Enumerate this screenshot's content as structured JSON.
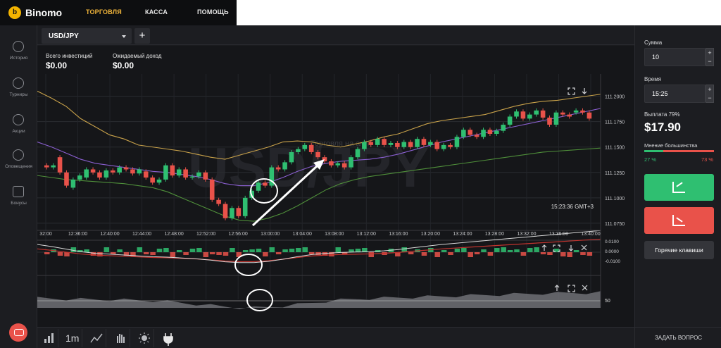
{
  "header": {
    "brand": "Binomo",
    "nav": [
      "ТОРГОВЛЯ",
      "КАССА",
      "ПОМОЩЬ"
    ]
  },
  "sidebar": {
    "items": [
      "История",
      "Турниры",
      "Акции",
      "Оповещения",
      "Бонусы"
    ]
  },
  "asset_tab": {
    "name": "USD/JPY",
    "add_label": "+"
  },
  "stats": {
    "investments_label": "Всего инвестиций",
    "investments_value": "$0.00",
    "income_label": "Ожидаемый доход",
    "income_value": "$0.00"
  },
  "chart": {
    "watermark": "USD/JPY",
    "watermark_caption": "Торговля на акти",
    "time_readout": "15:23:36 GMT+3",
    "indicator_level": "50",
    "colors": {
      "up": "#2fbf71",
      "down": "#e9524a",
      "upper_band": "#c9a24a",
      "mid_band": "#8a5fd0",
      "lower_band": "#4f8f3a",
      "macd_signal": "#c0332e",
      "macd_line": "#d9d9d9"
    }
  },
  "chart_data": {
    "type": "line",
    "x_ticks": [
      "32:00",
      "12:36:00",
      "12:40:00",
      "12:44:00",
      "12:48:00",
      "12:52:00",
      "12:56:00",
      "13:00:00",
      "13:04:00",
      "13:08:00",
      "13:12:00",
      "13:16:00",
      "13:20:00",
      "13:24:00",
      "13:28:00",
      "13:32:00",
      "13:36:00",
      "13:40:00"
    ],
    "y_ticks": [
      "111.2000",
      "111.1750",
      "111.1500",
      "111.1250",
      "111.1000",
      "111.0750"
    ],
    "macd_ticks": [
      "0.0100",
      "0.0000",
      "-0.0100"
    ],
    "ylim": [
      111.068,
      111.215
    ],
    "candles": [
      [
        111.132,
        111.13
      ],
      [
        111.13,
        111.132
      ],
      [
        111.14,
        111.125
      ],
      [
        111.125,
        111.112
      ],
      [
        111.11,
        111.118
      ],
      [
        111.118,
        111.122
      ],
      [
        111.12,
        111.128
      ],
      [
        111.128,
        111.125
      ],
      [
        111.125,
        111.12
      ],
      [
        111.12,
        111.127
      ],
      [
        111.127,
        111.125
      ],
      [
        111.125,
        111.13
      ],
      [
        111.13,
        111.128
      ],
      [
        111.128,
        111.124
      ],
      [
        111.124,
        111.128
      ],
      [
        111.126,
        111.12
      ],
      [
        111.12,
        111.115
      ],
      [
        111.115,
        111.118
      ],
      [
        111.118,
        111.132
      ],
      [
        111.132,
        111.122
      ],
      [
        111.122,
        111.128
      ],
      [
        111.128,
        111.12
      ],
      [
        111.12,
        111.121
      ],
      [
        111.121,
        111.125
      ],
      [
        111.125,
        111.118
      ],
      [
        111.118,
        111.098
      ],
      [
        111.098,
        111.094
      ],
      [
        111.094,
        111.08
      ],
      [
        111.08,
        111.09
      ],
      [
        111.09,
        111.082
      ],
      [
        111.082,
        111.1
      ],
      [
        111.1,
        111.107
      ],
      [
        111.107,
        111.115
      ],
      [
        111.115,
        111.112
      ],
      [
        111.112,
        111.13
      ],
      [
        111.13,
        111.128
      ],
      [
        111.128,
        111.135
      ],
      [
        111.135,
        111.145
      ],
      [
        111.145,
        111.148
      ],
      [
        111.148,
        111.152
      ],
      [
        111.152,
        111.145
      ],
      [
        111.145,
        111.14
      ],
      [
        111.14,
        111.136
      ],
      [
        111.136,
        111.132
      ],
      [
        111.132,
        111.134
      ],
      [
        111.134,
        111.13
      ],
      [
        111.13,
        111.14
      ],
      [
        111.14,
        111.148
      ],
      [
        111.148,
        111.155
      ],
      [
        111.155,
        111.152
      ],
      [
        111.152,
        111.158
      ],
      [
        111.158,
        111.152
      ],
      [
        111.152,
        111.154
      ],
      [
        111.154,
        111.15
      ],
      [
        111.15,
        111.155
      ],
      [
        111.155,
        111.15
      ],
      [
        111.15,
        111.158
      ],
      [
        111.158,
        111.152
      ],
      [
        111.152,
        111.155
      ],
      [
        111.155,
        111.148
      ],
      [
        111.148,
        111.152
      ],
      [
        111.152,
        111.15
      ],
      [
        111.15,
        111.16
      ],
      [
        111.16,
        111.167
      ],
      [
        111.167,
        111.162
      ],
      [
        111.162,
        111.16
      ],
      [
        111.16,
        111.167
      ],
      [
        111.167,
        111.163
      ],
      [
        111.163,
        111.166
      ],
      [
        111.166,
        111.172
      ],
      [
        111.172,
        111.18
      ],
      [
        111.18,
        111.185
      ],
      [
        111.185,
        111.178
      ],
      [
        111.178,
        111.182
      ],
      [
        111.182,
        111.186
      ],
      [
        111.186,
        111.179
      ],
      [
        111.179,
        111.172
      ],
      [
        111.172,
        111.184
      ],
      [
        111.184,
        111.182
      ],
      [
        111.182,
        111.18
      ],
      [
        111.184,
        111.186
      ],
      [
        111.186,
        111.184
      ],
      [
        111.184,
        111.178
      ]
    ],
    "series": [
      {
        "values": [
          111.205,
          111.198,
          111.19,
          111.178,
          111.17,
          111.162,
          111.158,
          111.152,
          111.15,
          111.148,
          111.146,
          111.143,
          111.14,
          111.138,
          111.142,
          111.146,
          111.15,
          111.155,
          111.156,
          111.155,
          111.152,
          111.15,
          111.153,
          111.156,
          111.16,
          111.163,
          111.168,
          111.173,
          111.176,
          111.178,
          111.18,
          111.182,
          111.186,
          111.19,
          111.193,
          111.195,
          111.196,
          111.198,
          111.2,
          111.202
        ]
      },
      {
        "values": [
          111.155,
          111.15,
          111.144,
          111.138,
          111.134,
          111.132,
          111.13,
          111.128,
          111.126,
          111.125,
          111.123,
          111.121,
          111.118,
          111.114,
          111.112,
          111.112,
          111.115,
          111.12,
          111.126,
          111.131,
          111.134,
          111.136,
          111.137,
          111.138,
          111.14,
          111.143,
          111.147,
          111.151,
          111.155,
          111.158,
          111.161,
          111.164,
          111.167,
          111.17,
          111.173,
          111.176,
          111.179,
          111.182,
          111.185,
          111.188
        ]
      },
      {
        "values": [
          111.122,
          111.12,
          111.118,
          111.117,
          111.116,
          111.115,
          111.114,
          111.112,
          111.11,
          111.106,
          111.1,
          111.094,
          111.088,
          111.082,
          111.078,
          111.077,
          111.08,
          111.085,
          111.092,
          111.1,
          111.108,
          111.114,
          111.118,
          111.121,
          111.123,
          111.125,
          111.127,
          111.129,
          111.131,
          111.133,
          111.135,
          111.137,
          111.139,
          111.141,
          111.143,
          111.145,
          111.146,
          111.147,
          111.148,
          111.149
        ]
      }
    ]
  },
  "panel": {
    "amount_label": "Сумма",
    "amount_value": "10",
    "time_label": "Время",
    "time_value": "15:25",
    "step_up": "+",
    "step_down": "−",
    "payout_label": "Выплата 79%",
    "payout_value": "$17.90",
    "majority_label": "Мнение большинства",
    "up_percent": "27 %",
    "down_percent": "73 %",
    "hotkeys_label": "Горячие клавиши",
    "up_color": "#2fbf71",
    "down_color": "#e9524a"
  },
  "toolbar": {
    "timeframe": "1m",
    "icons": [
      "chart-type-icon",
      "timeframe",
      "indicators-icon",
      "hand-icon",
      "theme-icon",
      "plugin-icon"
    ]
  },
  "footer": {
    "ask_label": "ЗАДАТЬ ВОПРОС"
  }
}
